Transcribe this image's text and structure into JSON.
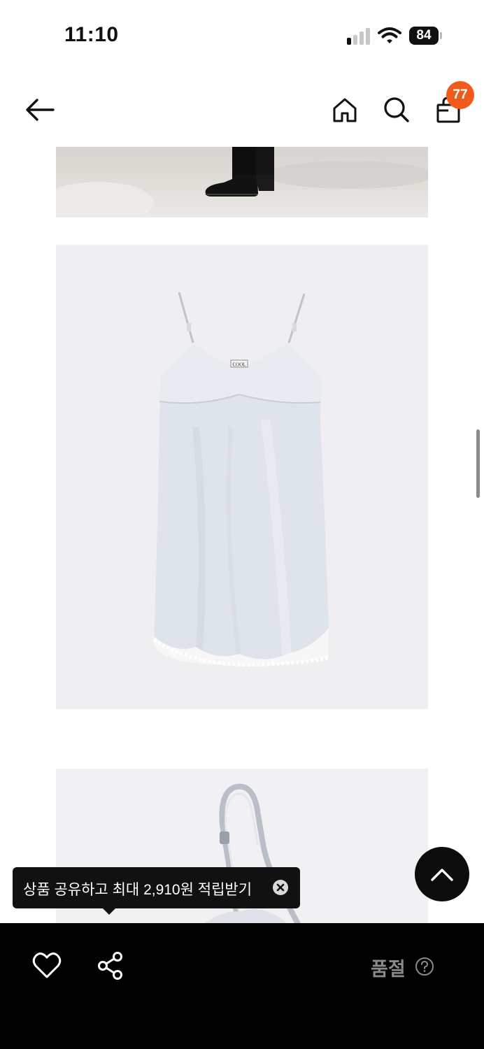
{
  "status_bar": {
    "time": "11:10",
    "battery": "84",
    "icons": [
      "signal-icon",
      "wifi-icon",
      "battery-icon"
    ]
  },
  "nav": {
    "icons": [
      "back-arrow-icon",
      "home-icon",
      "search-icon",
      "shopping-bag-icon"
    ],
    "cart_count": "77",
    "badge_color": "#f05a1a"
  },
  "product_images": {
    "label_text": "COOL",
    "images": [
      "street-photo",
      "dress-flat-lay",
      "dress-strap-closeup"
    ]
  },
  "tooltip": {
    "text": "상품 공유하고 최대 2,910원 적립받기"
  },
  "bottom_bar": {
    "status_label": "품절",
    "icons": [
      "heart-icon",
      "share-icon",
      "help-icon"
    ],
    "background": "#000000"
  },
  "scroll_top": {
    "icon": "chevron-up-icon"
  }
}
